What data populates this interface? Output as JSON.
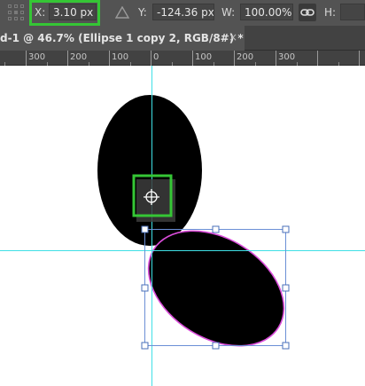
{
  "options_bar": {
    "x_label": "X:",
    "x_value": "3.10 px",
    "y_label": "Y:",
    "y_value": "-124.36 px",
    "w_label": "W:",
    "w_value": "100.00%",
    "h_label": "H:",
    "icons": [
      "reference-point-icon",
      "delta-icon",
      "link-icon"
    ]
  },
  "document_tab": {
    "title": "d-1 @ 46.7% (Ellipse 1 copy 2, RGB/8#) *",
    "close": "×"
  },
  "ruler": {
    "labels": [
      "300",
      "200",
      "100",
      "0",
      "100",
      "200",
      "300"
    ]
  },
  "colors": {
    "highlight_green": "#35c635",
    "guide_cyan": "#3fe0e6",
    "selection_magenta": "#d94cd9",
    "bounding_box_blue": "#6b8fd6"
  }
}
